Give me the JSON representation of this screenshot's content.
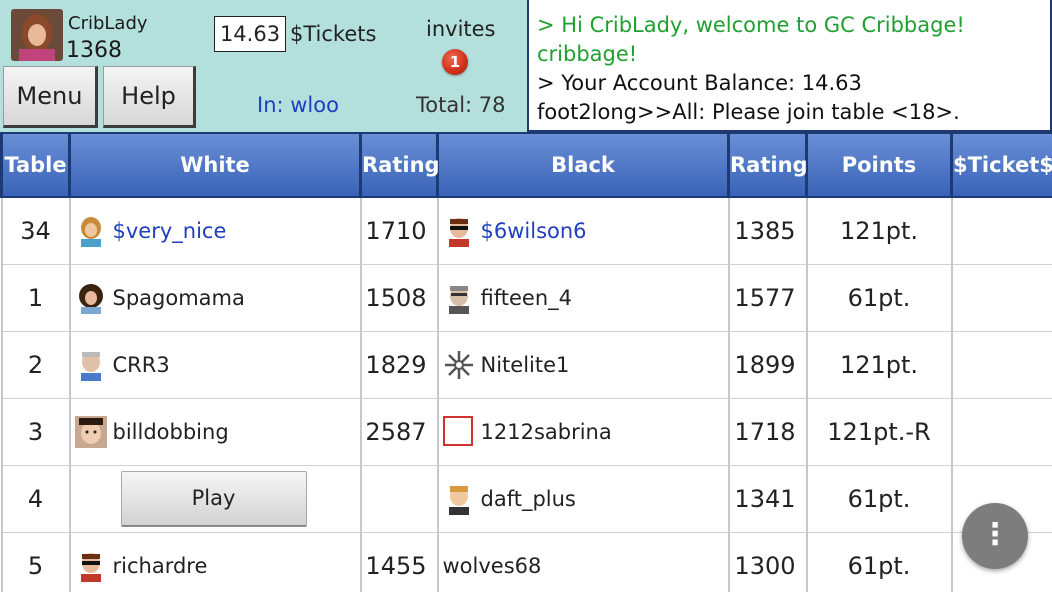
{
  "header": {
    "username": "CribLady",
    "user_rating": "1368",
    "balance": "14.63",
    "tickets_label": "$Tickets",
    "invites_label": "invites",
    "invites_count": "1",
    "menu_label": "Menu",
    "help_label": "Help",
    "room_label": "In: wloo",
    "total_label": "Total: 78"
  },
  "chat": {
    "lines": [
      "> Hi  CribLady, welcome to GC Cribbage!",
      "cribbage!",
      "> Your Account Balance: 14.63",
      "foot2long>>All: Please join table <18>."
    ]
  },
  "table": {
    "headers": [
      "Table",
      "White",
      "Rating",
      "Black",
      "Rating",
      "Points",
      "$Ticket$"
    ],
    "rows": [
      {
        "table": "34",
        "white": "$very_nice",
        "white_rating": "1710",
        "black": "$6wilson6",
        "black_rating": "1385",
        "points": "121pt.",
        "ticket": ""
      },
      {
        "table": "1",
        "white": "Spagomama",
        "white_rating": "1508",
        "black": "fifteen_4",
        "black_rating": "1577",
        "points": "61pt.",
        "ticket": ""
      },
      {
        "table": "2",
        "white": "CRR3",
        "white_rating": "1829",
        "black": "Nitelite1",
        "black_rating": "1899",
        "points": "121pt.",
        "ticket": ""
      },
      {
        "table": "3",
        "white": "billdobbing",
        "white_rating": "2587",
        "black": "1212sabrina",
        "black_rating": "1718",
        "points": "121pt.-R",
        "ticket": ""
      },
      {
        "table": "4",
        "white": "",
        "white_rating": "",
        "black": "daft_plus",
        "black_rating": "1341",
        "points": "61pt.",
        "ticket": ""
      },
      {
        "table": "5",
        "white": "richardre",
        "white_rating": "1455",
        "black": "wolves68",
        "black_rating": "1300",
        "points": "61pt.",
        "ticket": ""
      }
    ],
    "play_label": "Play"
  },
  "fab_label": "⋮",
  "colors": {
    "header_bg": "#b3e0dd",
    "table_header": "#4a72c4",
    "link_blue": "#1f3fbf",
    "chat_green": "#20a030",
    "badge_red": "#d2321c"
  }
}
